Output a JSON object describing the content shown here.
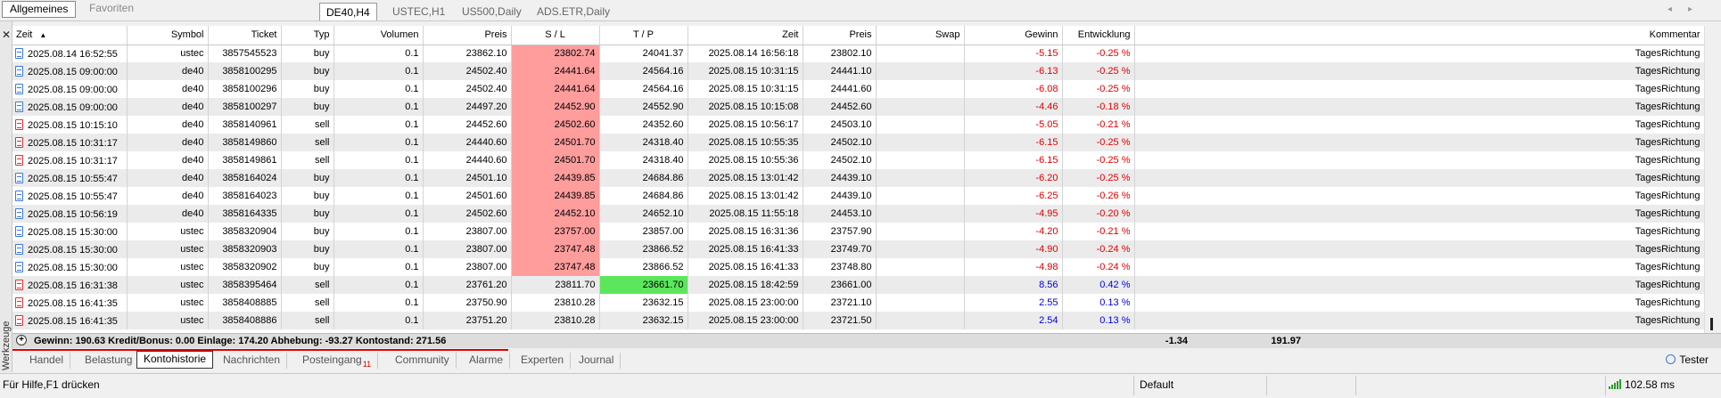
{
  "nav": {
    "tabs": [
      "Allgemeines",
      "Favoriten"
    ]
  },
  "chart_tabs": [
    "DE40,H4",
    "USTEC,H1",
    "US500,Daily",
    "ADS.ETR,Daily"
  ],
  "left_panel_label": "Werkzeuge",
  "table": {
    "columns": [
      "Zeit",
      "Symbol",
      "Ticket",
      "Typ",
      "Volumen",
      "Preis",
      "S / L",
      "T / P",
      "Zeit",
      "Preis",
      "Swap",
      "Gewinn",
      "Entwicklung",
      "Kommentar"
    ],
    "rows": [
      [
        "2025.08.14 16:52:55",
        "ustec",
        "3857545523",
        "buy",
        "0.1",
        "23862.10",
        "23802.74",
        "24041.37",
        "2025.08.14 16:56:18",
        "23802.10",
        "",
        "-5.15",
        "-0.25 %",
        "TagesRichtung"
      ],
      [
        "2025.08.15 09:00:00",
        "de40",
        "3858100295",
        "buy",
        "0.1",
        "24502.40",
        "24441.64",
        "24564.16",
        "2025.08.15 10:31:15",
        "24441.10",
        "",
        "-6.13",
        "-0.25 %",
        "TagesRichtung"
      ],
      [
        "2025.08.15 09:00:00",
        "de40",
        "3858100296",
        "buy",
        "0.1",
        "24502.40",
        "24441.64",
        "24564.16",
        "2025.08.15 10:31:15",
        "24441.60",
        "",
        "-6.08",
        "-0.25 %",
        "TagesRichtung"
      ],
      [
        "2025.08.15 09:00:00",
        "de40",
        "3858100297",
        "buy",
        "0.1",
        "24497.20",
        "24452.90",
        "24552.90",
        "2025.08.15 10:15:08",
        "24452.60",
        "",
        "-4.46",
        "-0.18 %",
        "TagesRichtung"
      ],
      [
        "2025.08.15 10:15:10",
        "de40",
        "3858140961",
        "sell",
        "0.1",
        "24452.60",
        "24502.60",
        "24352.60",
        "2025.08.15 10:56:17",
        "24503.10",
        "",
        "-5.05",
        "-0.21 %",
        "TagesRichtung"
      ],
      [
        "2025.08.15 10:31:17",
        "de40",
        "3858149860",
        "sell",
        "0.1",
        "24440.60",
        "24501.70",
        "24318.40",
        "2025.08.15 10:55:35",
        "24502.10",
        "",
        "-6.15",
        "-0.25 %",
        "TagesRichtung"
      ],
      [
        "2025.08.15 10:31:17",
        "de40",
        "3858149861",
        "sell",
        "0.1",
        "24440.60",
        "24501.70",
        "24318.40",
        "2025.08.15 10:55:36",
        "24502.10",
        "",
        "-6.15",
        "-0.25 %",
        "TagesRichtung"
      ],
      [
        "2025.08.15 10:55:47",
        "de40",
        "3858164024",
        "buy",
        "0.1",
        "24501.10",
        "24439.85",
        "24684.86",
        "2025.08.15 13:01:42",
        "24439.10",
        "",
        "-6.20",
        "-0.25 %",
        "TagesRichtung"
      ],
      [
        "2025.08.15 10:55:47",
        "de40",
        "3858164023",
        "buy",
        "0.1",
        "24501.60",
        "24439.85",
        "24684.86",
        "2025.08.15 13:01:42",
        "24439.10",
        "",
        "-6.25",
        "-0.26 %",
        "TagesRichtung"
      ],
      [
        "2025.08.15 10:56:19",
        "de40",
        "3858164335",
        "buy",
        "0.1",
        "24502.60",
        "24452.10",
        "24652.10",
        "2025.08.15 11:55:18",
        "24453.10",
        "",
        "-4.95",
        "-0.20 %",
        "TagesRichtung"
      ],
      [
        "2025.08.15 15:30:00",
        "ustec",
        "3858320904",
        "buy",
        "0.1",
        "23807.00",
        "23757.00",
        "23857.00",
        "2025.08.15 16:31:36",
        "23757.90",
        "",
        "-4.20",
        "-0.21 %",
        "TagesRichtung"
      ],
      [
        "2025.08.15 15:30:00",
        "ustec",
        "3858320903",
        "buy",
        "0.1",
        "23807.00",
        "23747.48",
        "23866.52",
        "2025.08.15 16:41:33",
        "23749.70",
        "",
        "-4.90",
        "-0.24 %",
        "TagesRichtung"
      ],
      [
        "2025.08.15 15:30:00",
        "ustec",
        "3858320902",
        "buy",
        "0.1",
        "23807.00",
        "23747.48",
        "23866.52",
        "2025.08.15 16:41:33",
        "23748.80",
        "",
        "-4.98",
        "-0.24 %",
        "TagesRichtung"
      ],
      [
        "2025.08.15 16:31:38",
        "ustec",
        "3858395464",
        "sell",
        "0.1",
        "23761.20",
        "23811.70",
        "23661.70",
        "2025.08.15 18:42:59",
        "23661.00",
        "",
        "8.56",
        "0.42 %",
        "TagesRichtung"
      ],
      [
        "2025.08.15 16:41:35",
        "ustec",
        "3858408885",
        "sell",
        "0.1",
        "23750.90",
        "23810.28",
        "23632.15",
        "2025.08.15 23:00:00",
        "23721.10",
        "",
        "2.55",
        "0.13 %",
        "TagesRichtung"
      ],
      [
        "2025.08.15 16:41:35",
        "ustec",
        "3858408886",
        "sell",
        "0.1",
        "23751.20",
        "23810.28",
        "23632.15",
        "2025.08.15 23:00:00",
        "23721.50",
        "",
        "2.54",
        "0.13 %",
        "TagesRichtung"
      ]
    ],
    "sl_hit_rows": [
      0,
      1,
      2,
      3,
      4,
      5,
      6,
      7,
      8,
      9,
      10,
      11,
      12
    ],
    "tp_hit_rows": [
      13
    ]
  },
  "summary": {
    "text": "Gewinn: 190.63  Kredit/Bonus: 0.00  Einlage: 174.20  Abhebung: -93.27  Kontostand: 271.56",
    "swap_total": "-1.34",
    "gewinn_total": "191.97"
  },
  "bottom_tabs": [
    {
      "label": "Handel"
    },
    {
      "label": "Belastung"
    },
    {
      "label": "Kontohistorie",
      "active": true
    },
    {
      "label": "Nachrichten"
    },
    {
      "label": "Posteingang",
      "badge": "11"
    },
    {
      "label": "Community"
    },
    {
      "label": "Alarme"
    },
    {
      "label": "Experten"
    },
    {
      "label": "Journal"
    }
  ],
  "tester_label": "Tester",
  "status": {
    "help": "Für Hilfe,F1 drücken",
    "profile": "Default",
    "ping": "102.58 ms"
  },
  "colors": {
    "sl_hit": "#ff9d9d",
    "tp_hit": "#5ce65c",
    "negative": "#e00000",
    "positive": "#0000e0"
  }
}
